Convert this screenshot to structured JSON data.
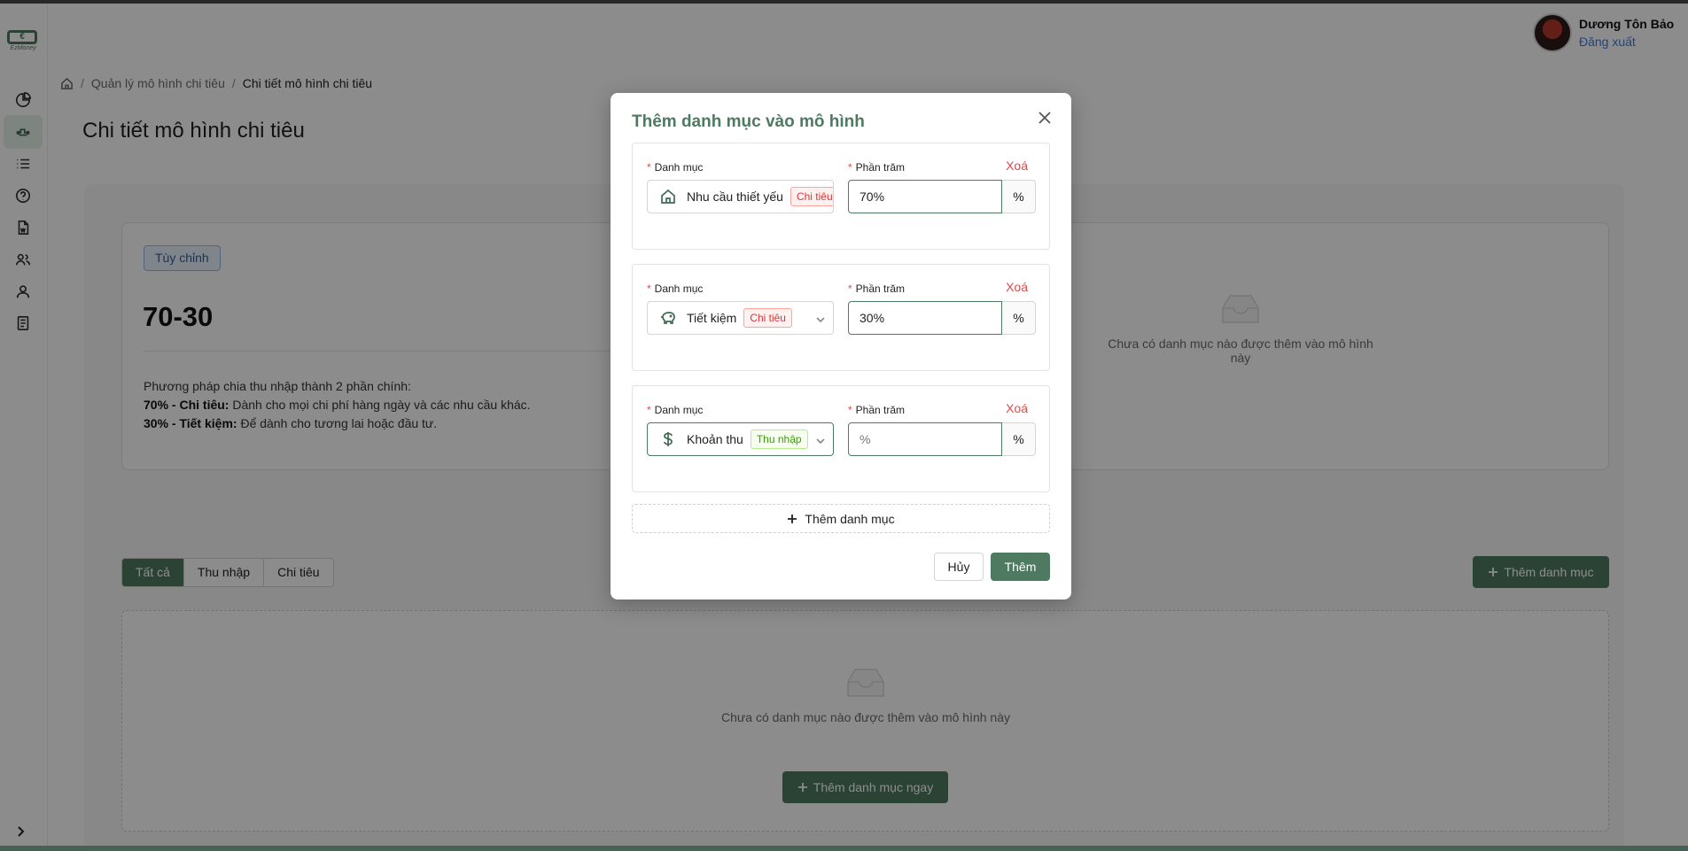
{
  "app": {
    "logo_text": "€",
    "logo_sub": "EzMoney"
  },
  "user": {
    "name": "Dương Tôn Bảo",
    "logout": "Đăng xuất"
  },
  "breadcrumb": {
    "items": [
      "Quản lý mô hình chi tiêu",
      "Chi tiết mô hình chi tiêu"
    ]
  },
  "page": {
    "title": "Chi tiết mô hình chi tiêu"
  },
  "model": {
    "tag": "Tùy chỉnh",
    "name": "70-30",
    "desc_intro": "Phương pháp chia thu nhập thành 2 phần chính:",
    "line1_bold": "70% - Chi tiêu:",
    "line1_text": " Dành cho mọi chi phí hàng ngày và các nhu cầu khác.",
    "line2_bold": "30% - Tiết kiệm:",
    "line2_text": " Để dành cho tương lai hoặc đầu tư.",
    "empty_text": "Chưa có danh mục nào được thêm vào mô hình này"
  },
  "filters": {
    "tabs": [
      "Tất cả",
      "Thu nhập",
      "Chi tiêu"
    ],
    "active": "Tất cả"
  },
  "actions": {
    "add_category": "Thêm danh mục",
    "add_now": "Thêm danh mục ngay"
  },
  "list": {
    "empty_text": "Chưa có danh mục nào được thêm vào mô hình này"
  },
  "modal": {
    "title": "Thêm danh mục vào mô hình",
    "label_category": "Danh mục",
    "label_percent": "Phần trăm",
    "delete": "Xoá",
    "percent_suffix": "%",
    "rows": [
      {
        "category": "Nhu cầu thiết yếu",
        "type": "Chi tiêu",
        "icon": "home-icon",
        "percent": "70%",
        "percent_placeholder": "%"
      },
      {
        "category": "Tiết kiệm",
        "type": "Chi tiêu",
        "icon": "piggy-bank-icon",
        "percent": "30%",
        "percent_placeholder": "%"
      },
      {
        "category": "Khoản thu",
        "type": "Thu nhập",
        "icon": "dollar-icon",
        "percent": "",
        "percent_placeholder": "%"
      }
    ],
    "add_row": "Thêm danh mục",
    "cancel": "Hủy",
    "submit": "Thêm"
  },
  "colors": {
    "brand": "#4f7a62",
    "danger": "#e04848",
    "link": "#3a7be0"
  }
}
